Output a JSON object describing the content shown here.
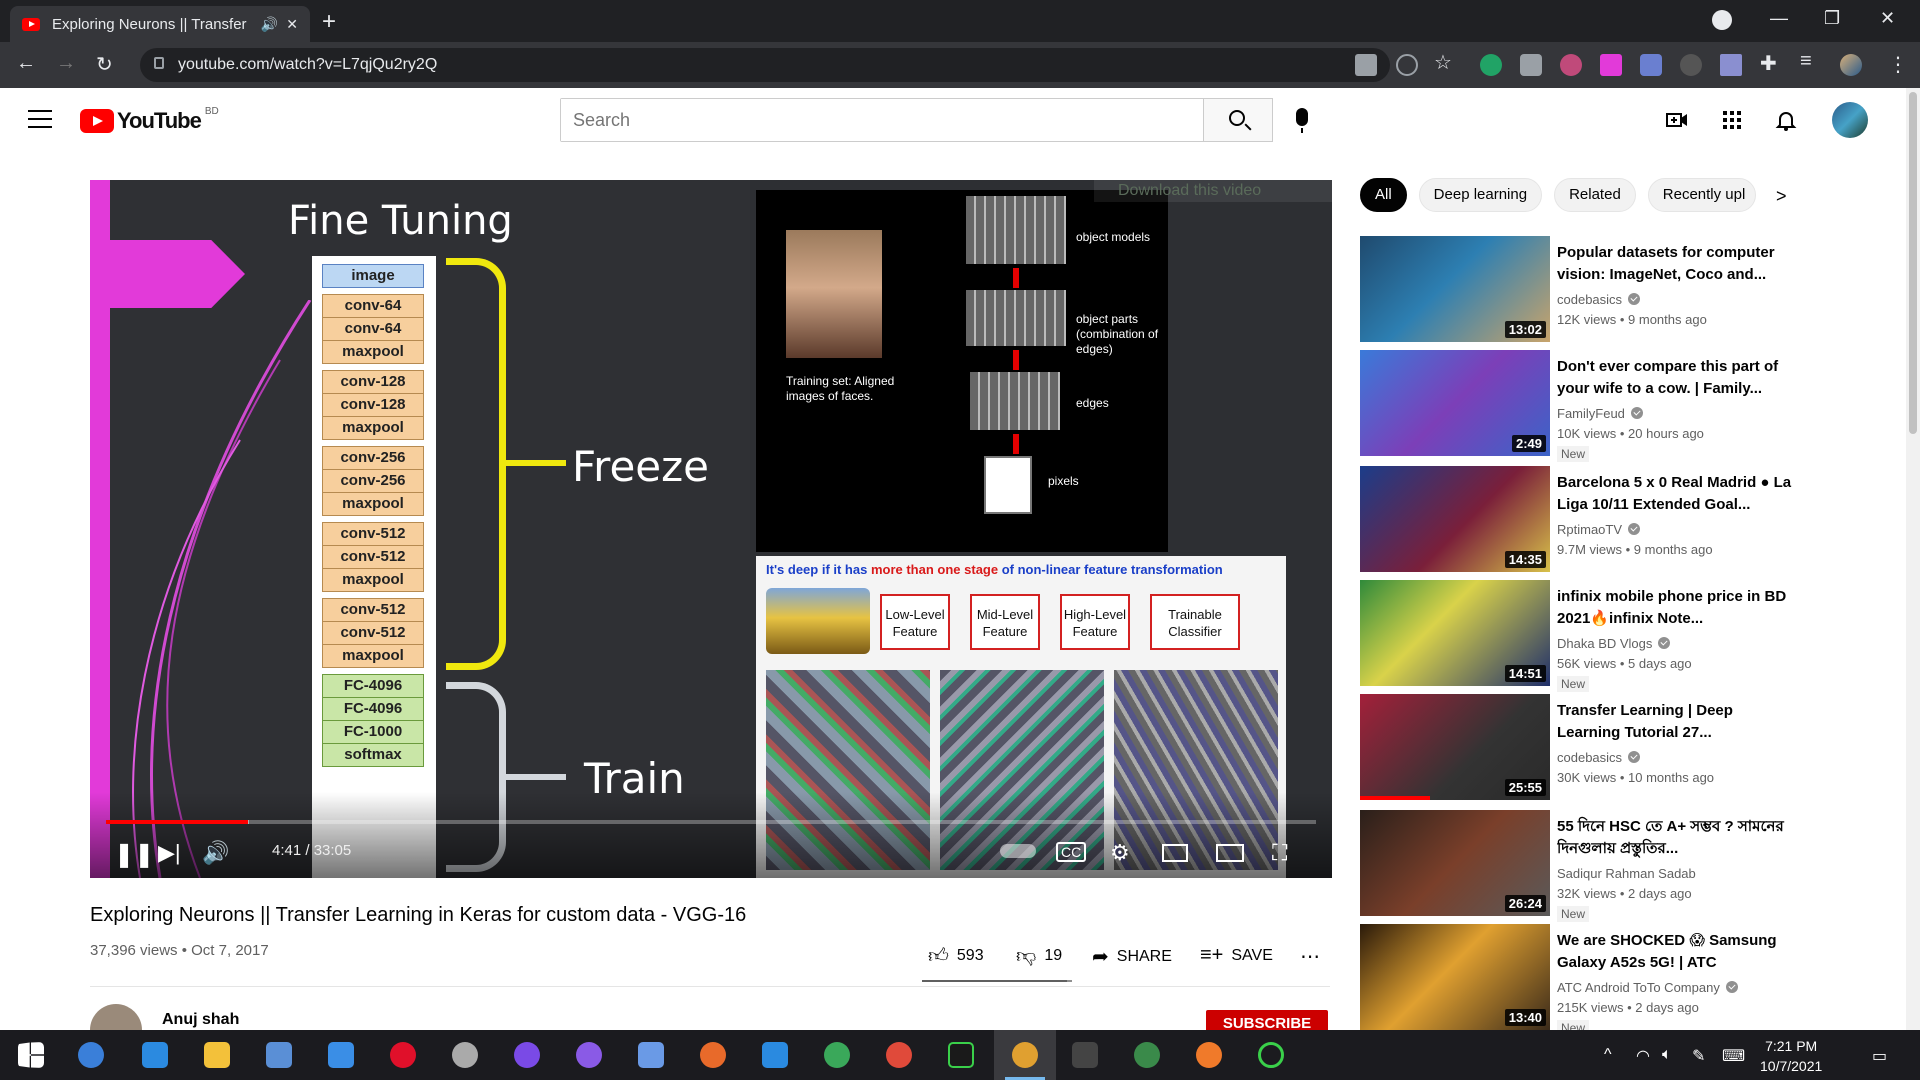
{
  "browser": {
    "tab_title": "Exploring Neurons || Transfer",
    "url": "youtube.com/watch?v=L7qjQu2ry2Q"
  },
  "header": {
    "logo_text": "YouTube",
    "country_code": "BD",
    "search_placeholder": "Search"
  },
  "video": {
    "slide": {
      "title": "Fine Tuning",
      "layers": [
        "image",
        "conv-64",
        "conv-64",
        "maxpool",
        "conv-128",
        "conv-128",
        "maxpool",
        "conv-256",
        "conv-256",
        "maxpool",
        "conv-512",
        "conv-512",
        "maxpool",
        "conv-512",
        "conv-512",
        "maxpool",
        "FC-4096",
        "FC-4096",
        "FC-1000",
        "softmax"
      ],
      "freeze_label": "Freeze",
      "train_label": "Train",
      "panel_labels": [
        "object models",
        "object parts (combination of edges)",
        "edges",
        "pixels"
      ],
      "training_set_text": "Training set: Aligned images of faces.",
      "deep_text_a": "It's deep if it has ",
      "deep_text_b": "more than one stage",
      "deep_text_c": " of non-linear feature transformation",
      "feature_boxes": [
        "Low-Level Feature",
        "Mid-Level Feature",
        "High-Level Feature",
        "Trainable Classifier"
      ]
    },
    "download_overlay": "Download this video",
    "time": "4:41 / 33:05",
    "progress_played": 0.117,
    "progress_loaded": 0.118,
    "title": "Exploring Neurons || Transfer Learning in Keras for custom data - VGG-16",
    "views_date": "37,396 views • Oct 7, 2017",
    "likes": "593",
    "dislikes": "19",
    "share_label": "SHARE",
    "save_label": "SAVE",
    "like_ratio": 0.969,
    "channel_name": "Anuj shah",
    "subscribe_label": "SUBSCRIBE"
  },
  "chips": [
    "All",
    "Deep learning",
    "Related",
    "Recently upl"
  ],
  "recommendations": [
    {
      "title": "Popular datasets for computer vision: ImageNet, Coco and...",
      "channel": "codebasics",
      "verified": true,
      "meta": "12K views • 9 months ago",
      "duration": "13:02",
      "new": "",
      "thumb": "linear-gradient(135deg,#1f4a6e,#2d7fb2 45%,#c9a46b)"
    },
    {
      "title": "Don't ever compare this part of your wife to a cow. | Family...",
      "channel": "FamilyFeud",
      "verified": true,
      "meta": "10K views • 20 hours ago",
      "duration": "2:49",
      "new": "New",
      "thumb": "linear-gradient(135deg,#3a7ad9,#7c3fb8 50%,#3b64c8)"
    },
    {
      "title": "Barcelona 5 x 0 Real Madrid ● La Liga 10/11 Extended Goal...",
      "channel": "RptimaoTV",
      "verified": true,
      "meta": "9.7M views • 9 months ago",
      "duration": "14:35",
      "new": "",
      "thumb": "linear-gradient(135deg,#1b3d8a,#7a1f3a 55%,#d8c24a)"
    },
    {
      "title": "infinix mobile phone price in BD 2021🔥infinix Note...",
      "channel": "Dhaka BD Vlogs",
      "verified": true,
      "meta": "56K views • 5 days ago",
      "duration": "14:51",
      "new": "New",
      "thumb": "linear-gradient(135deg,#2f8a3a,#d9d24a 40%,#1e2e6a)"
    },
    {
      "title": "Transfer Learning | Deep Learning Tutorial 27...",
      "channel": "codebasics",
      "verified": true,
      "meta": "30K views • 10 months ago",
      "duration": "25:55",
      "new": "",
      "thumb": "linear-gradient(135deg,#a3203a,#333 60%,#2a2a2a)"
    },
    {
      "title": "55 দিনে HSC তে A+ সম্ভব ? সামনের দিনগুলায় প্রস্তুতির...",
      "channel": "Sadiqur Rahman Sadab",
      "verified": false,
      "meta": "32K views • 2 days ago",
      "duration": "26:24",
      "new": "New",
      "thumb": "linear-gradient(135deg,#2a1f1a,#7a3f2a 50%,#5a5a5a)"
    },
    {
      "title": "We are SHOCKED 😱 Samsung Galaxy A52s 5G! | ATC",
      "channel": "ATC Android ToTo Company",
      "verified": true,
      "meta": "215K views • 2 days ago",
      "duration": "13:40",
      "new": "New",
      "thumb": "linear-gradient(135deg,#2a1a0a,#e0a030 45%,#3a2a1a)"
    }
  ],
  "taskbar": {
    "time": "7:21 PM",
    "date": "10/7/2021"
  }
}
